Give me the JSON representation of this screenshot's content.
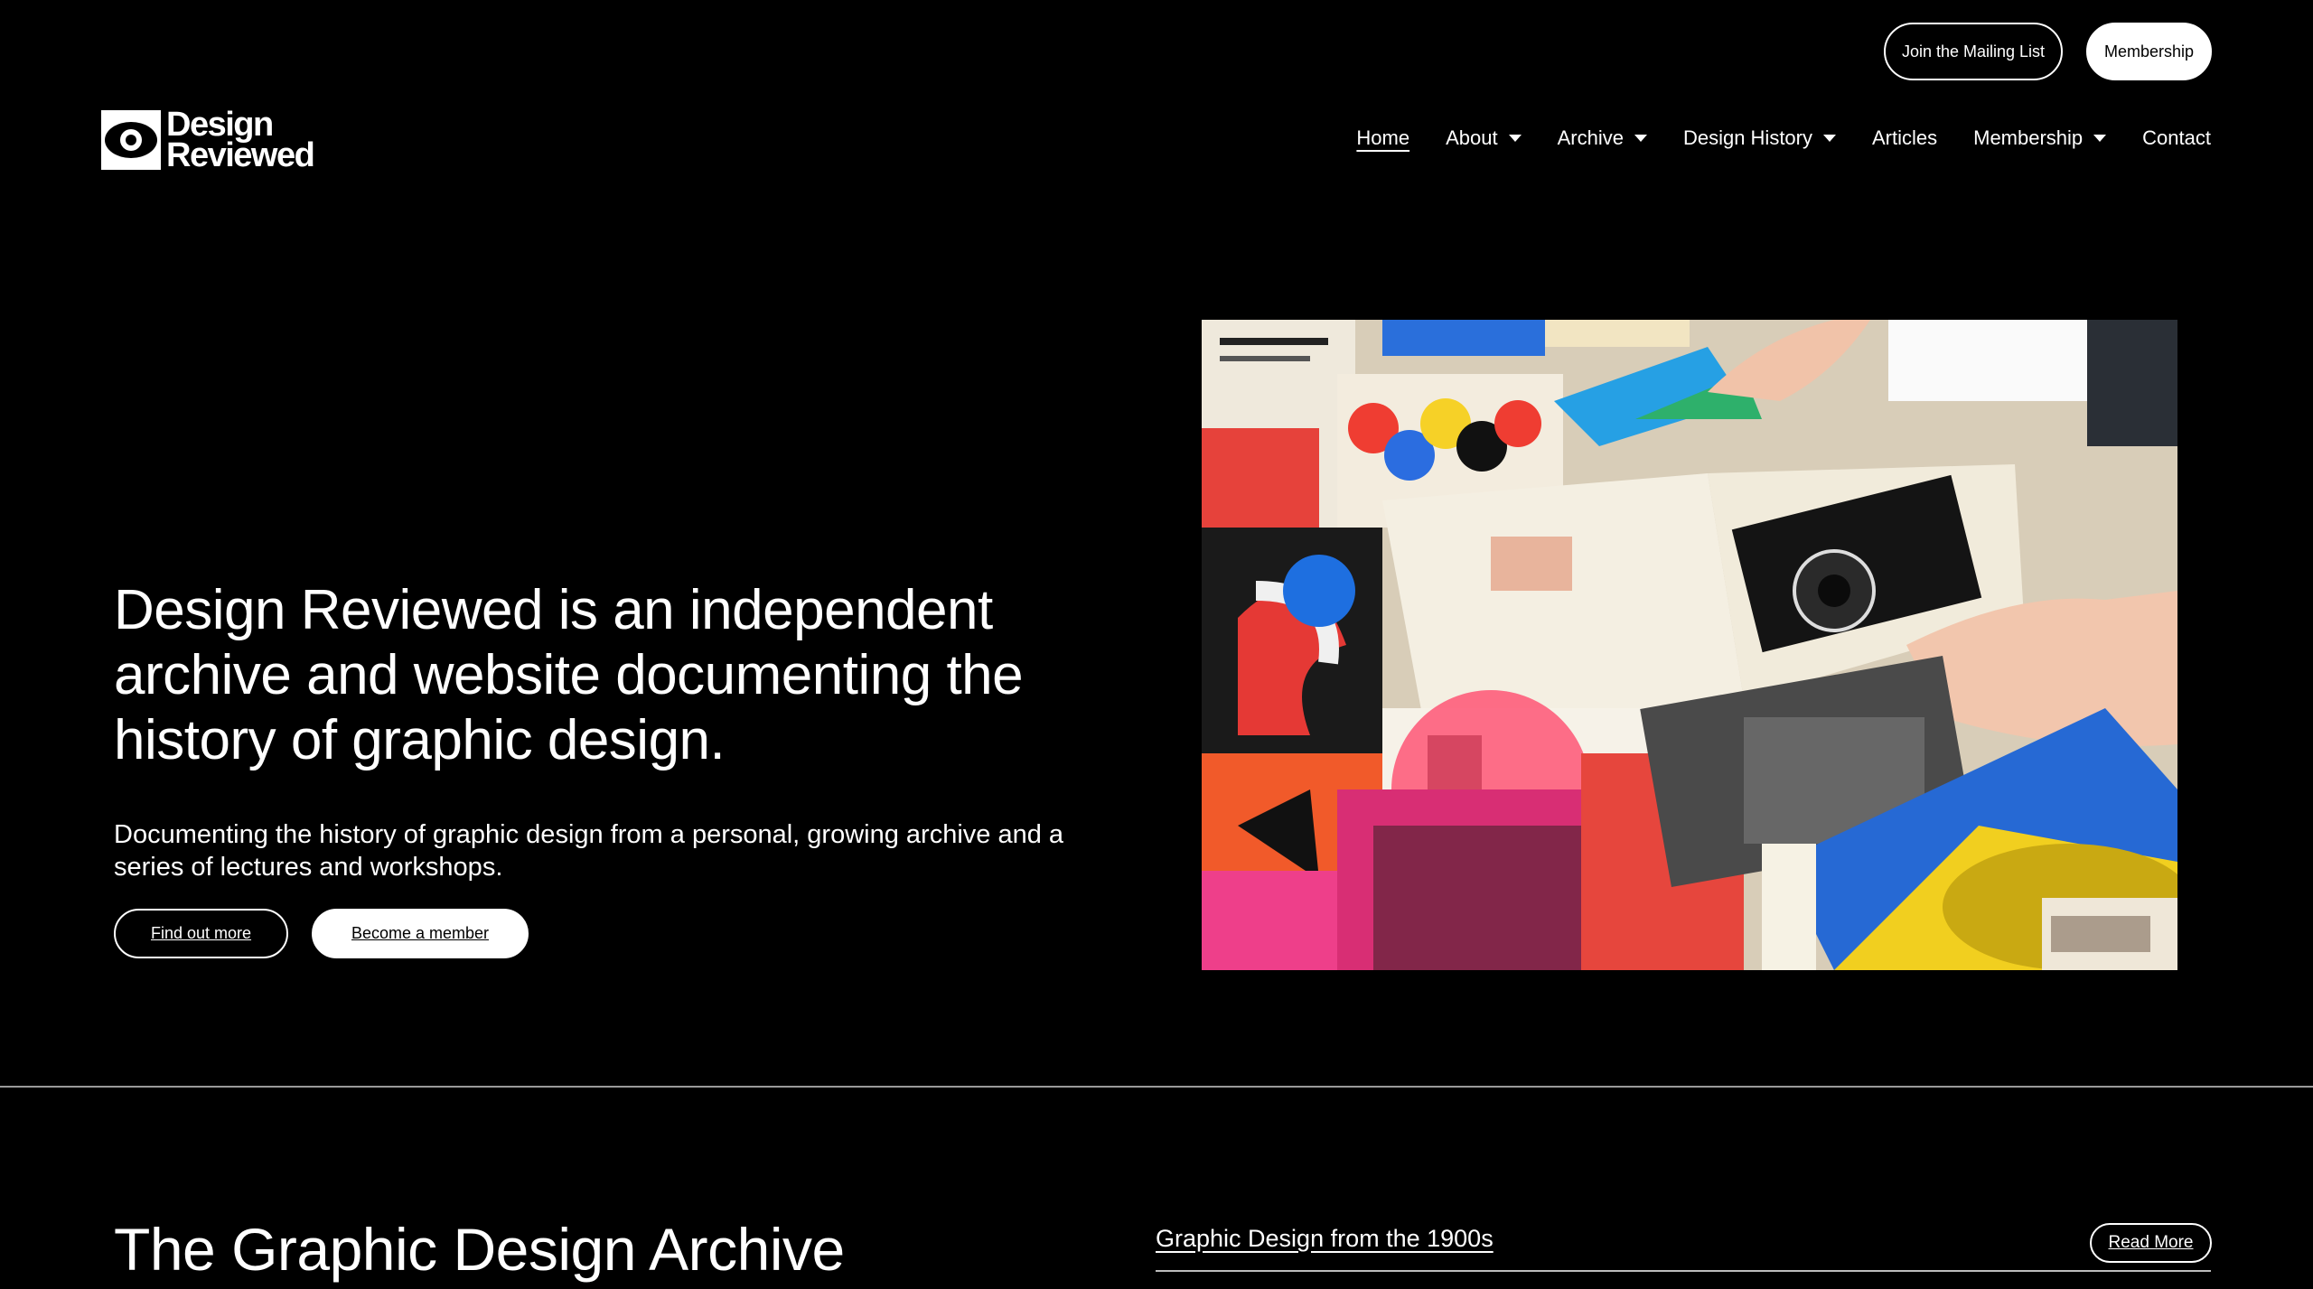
{
  "topbar": {
    "mailing_label": "Join the Mailing List",
    "membership_label": "Membership"
  },
  "logo": {
    "line1": "Design",
    "line2": "Reviewed"
  },
  "nav": {
    "items": [
      {
        "label": "Home",
        "active": true,
        "dropdown": false
      },
      {
        "label": "About",
        "dropdown": true
      },
      {
        "label": "Archive",
        "dropdown": true
      },
      {
        "label": "Design History",
        "dropdown": true
      },
      {
        "label": "Articles",
        "dropdown": false
      },
      {
        "label": "Membership",
        "dropdown": true
      },
      {
        "label": "Contact",
        "dropdown": false
      }
    ]
  },
  "hero": {
    "title": "Design Reviewed is an independent archive and website documenting the history of graphic design.",
    "subtitle": "Documenting the history of graphic design from a personal, growing archive and a series of lectures and workshops.",
    "primary_cta": "Find out more",
    "secondary_cta": "Become a member"
  },
  "archive": {
    "title": "The Graphic Design Archive",
    "link": "Graphic Design from the 1900s",
    "read_more": "Read More"
  },
  "colors": {
    "background": "#000000",
    "foreground": "#ffffff"
  }
}
